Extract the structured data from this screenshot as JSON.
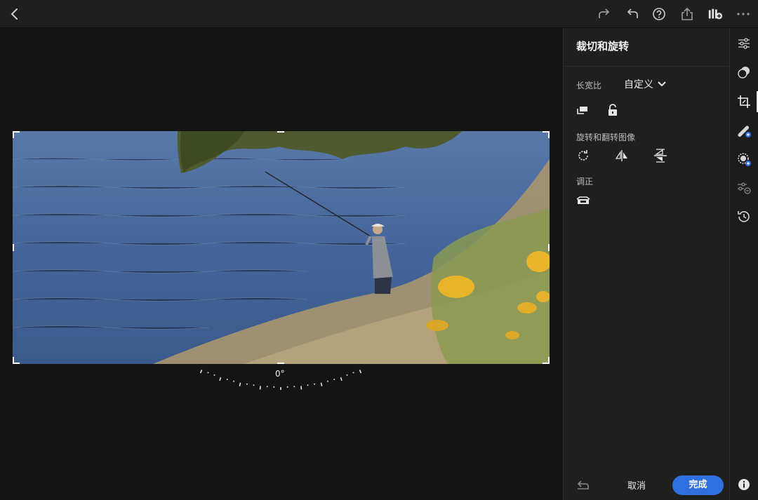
{
  "toolbar": {
    "icons": [
      "back-icon",
      "redo-icon",
      "undo-icon",
      "help-icon",
      "share-icon",
      "add-to-album-icon",
      "more-icon"
    ]
  },
  "panel": {
    "title": "裁切和旋转",
    "aspect_label": "长宽比",
    "aspect_value": "自定义",
    "rotate_section_label": "旋转和翻转图像",
    "straighten_label": "调正",
    "cancel_label": "取消",
    "done_label": "完成"
  },
  "canvas": {
    "rotation_readout": "0°"
  },
  "rail": {
    "icons": [
      "edit-sliders-icon",
      "presets-icon",
      "crop-icon",
      "healing-icon",
      "masking-icon",
      "versions-icon",
      "history-icon",
      "info-icon"
    ],
    "active": "crop-icon"
  },
  "colors": {
    "accent": "#2f6fe0",
    "panel_bg": "#1f1f1f",
    "canvas_bg": "#141414"
  }
}
